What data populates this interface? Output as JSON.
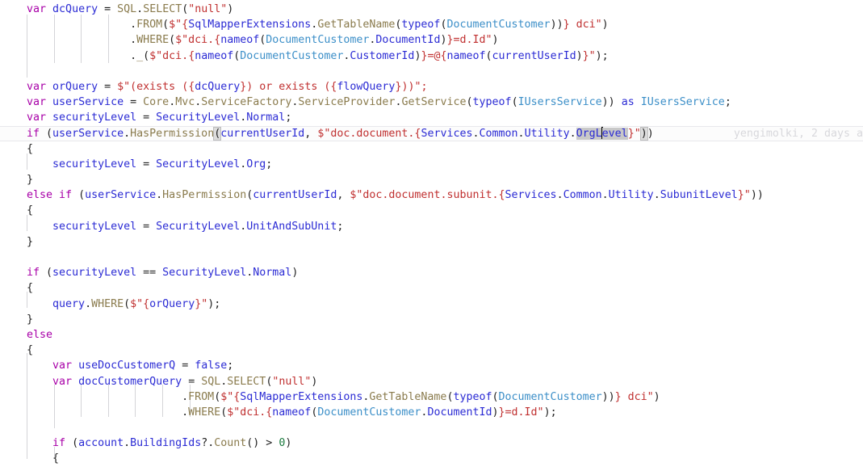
{
  "editor": {
    "language": "csharp",
    "background_color": "#ffffff",
    "current_line_number": 9,
    "selection_text": "OrgLevel",
    "caret_offset_in_selection": 4,
    "colors": {
      "keyword": "#a800a8",
      "identifier": "#2b2bd4",
      "type": "#3c8fc8",
      "method": "#8a7b4d",
      "string": "#c03030",
      "number": "#1a7a3e",
      "plain": "#222222",
      "selection_background": "#c8c8c8",
      "current_line_background": "#fcfcfc",
      "indent_guide": "#d4d4d8",
      "blame_text": "#d8d8dc"
    }
  },
  "blame_annotation": {
    "author": "yengimolki",
    "when": "2 days a",
    "text": "yengimolki, 2 days a"
  },
  "lines": [
    {
      "n": 1,
      "text": "var dcQuery = SQL.SELECT(\"null\")"
    },
    {
      "n": 2,
      "text": "                .FROM($\"{SqlMapperExtensions.GetTableName(typeof(DocumentCustomer))} dci\")"
    },
    {
      "n": 3,
      "text": "                .WHERE($\"dci.{nameof(DocumentCustomer.DocumentId)}=d.Id\")"
    },
    {
      "n": 4,
      "text": "                ._($\"dci.{nameof(DocumentCustomer.CustomerId)}=@{nameof(currentUserId)}\");"
    },
    {
      "n": 5,
      "text": ""
    },
    {
      "n": 6,
      "text": "var orQuery = $\"(exists ({dcQuery}) or exists ({flowQuery}))\";"
    },
    {
      "n": 7,
      "text": "var userService = Core.Mvc.ServiceFactory.ServiceProvider.GetService(typeof(IUsersService)) as IUsersService;"
    },
    {
      "n": 8,
      "text": "var securityLevel = SecurityLevel.Normal;"
    },
    {
      "n": 9,
      "text": "if (userService.HasPermission(currentUserId, $\"doc.document.{Services.Common.Utility.OrgLevel}\"))"
    },
    {
      "n": 10,
      "text": "{"
    },
    {
      "n": 11,
      "text": "    securityLevel = SecurityLevel.Org;"
    },
    {
      "n": 12,
      "text": "}"
    },
    {
      "n": 13,
      "text": "else if (userService.HasPermission(currentUserId, $\"doc.document.subunit.{Services.Common.Utility.SubunitLevel}\"))"
    },
    {
      "n": 14,
      "text": "{"
    },
    {
      "n": 15,
      "text": "    securityLevel = SecurityLevel.UnitAndSubUnit;"
    },
    {
      "n": 16,
      "text": "}"
    },
    {
      "n": 17,
      "text": ""
    },
    {
      "n": 18,
      "text": "if (securityLevel == SecurityLevel.Normal)"
    },
    {
      "n": 19,
      "text": "{"
    },
    {
      "n": 20,
      "text": "    query.WHERE($\"{orQuery}\");"
    },
    {
      "n": 21,
      "text": "}"
    },
    {
      "n": 22,
      "text": "else"
    },
    {
      "n": 23,
      "text": "{"
    },
    {
      "n": 24,
      "text": "    var useDocCustomerQ = false;"
    },
    {
      "n": 25,
      "text": "    var docCustomerQuery = SQL.SELECT(\"null\")"
    },
    {
      "n": 26,
      "text": "                        .FROM($\"{SqlMapperExtensions.GetTableName(typeof(DocumentCustomer))} dci\")"
    },
    {
      "n": 27,
      "text": "                        .WHERE($\"dci.{nameof(DocumentCustomer.DocumentId)}=d.Id\");"
    },
    {
      "n": 28,
      "text": ""
    },
    {
      "n": 29,
      "text": "    if (account.BuildingIds?.Count() > 0)"
    },
    {
      "n": 30,
      "text": "    {"
    }
  ],
  "identifiers": {
    "locals": [
      "dcQuery",
      "orQuery",
      "userService",
      "securityLevel",
      "currentUserId",
      "flowQuery",
      "useDocCustomerQ",
      "docCustomerQuery",
      "query",
      "account",
      "dci",
      "d"
    ],
    "types": [
      "DocumentCustomer",
      "IUsersService"
    ],
    "members": [
      "SQL",
      "SELECT",
      "FROM",
      "WHERE",
      "SqlMapperExtensions",
      "GetTableName",
      "nameof",
      "DocumentId",
      "CustomerId",
      "SecurityLevel",
      "Normal",
      "Org",
      "UnitAndSubUnit",
      "HasPermission",
      "Services",
      "Common",
      "Utility",
      "OrgLevel",
      "SubunitLevel",
      "Core",
      "Mvc",
      "ServiceFactory",
      "ServiceProvider",
      "GetService",
      "BuildingIds",
      "Count",
      "Id"
    ]
  }
}
